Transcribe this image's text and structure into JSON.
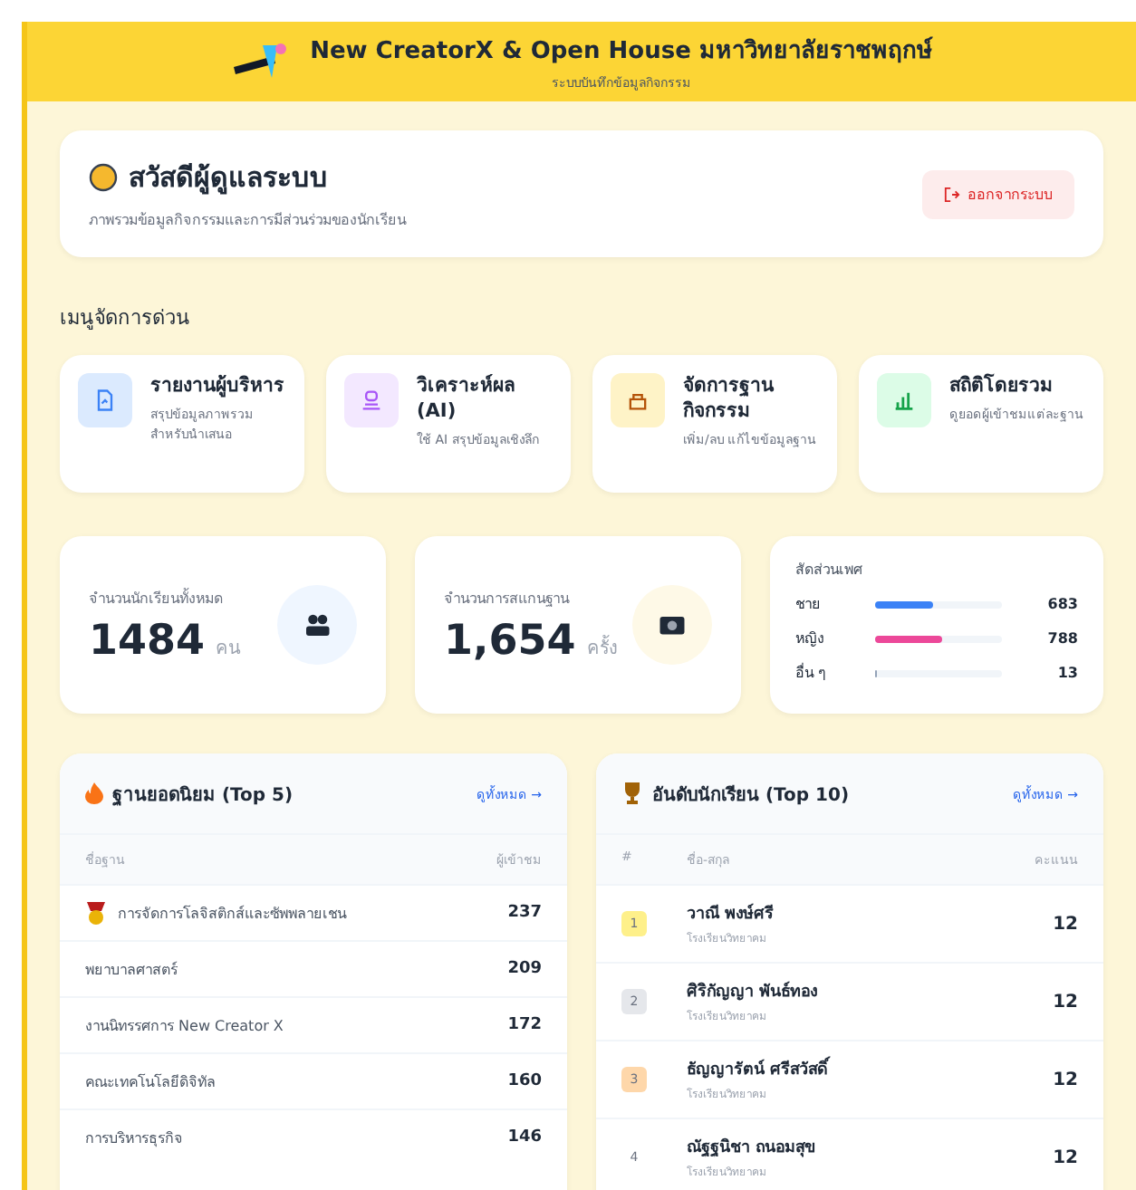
{
  "header": {
    "title": "New CreatorX & Open House มหาวิทยาลัยราชพฤกษ์",
    "subtitle": "ระบบบันทึกข้อมูลกิจกรรม"
  },
  "welcome": {
    "title": "สวัสดีผู้ดูแลระบบ",
    "subtitle": "ภาพรวมข้อมูลกิจกรรมและการมีส่วนร่วมของนักเรียน",
    "logout": "ออกจากระบบ"
  },
  "quick_menu": {
    "title": "เมนูจัดการด่วน",
    "items": [
      {
        "kind": "report",
        "title": "รายงานผู้บริหาร",
        "desc": "สรุปข้อมูลภาพรวมสำหรับนำเสนอ"
      },
      {
        "kind": "ai",
        "title": "วิเคราะห์ผล (AI)",
        "desc": "ใช้ AI สรุปข้อมูลเชิงลึก"
      },
      {
        "kind": "booth",
        "title": "จัดการฐานกิจกรรม",
        "desc": "เพิ่ม/ลบ แก้ไขข้อมูลฐาน"
      },
      {
        "kind": "stats",
        "title": "สถิติโดยรวม",
        "desc": "ดูยอดผู้เข้าชมแต่ละฐาน"
      }
    ]
  },
  "stats": [
    {
      "kind": "students",
      "label": "จำนวนนักเรียนทั้งหมด",
      "value": "1484",
      "unit": "คน"
    },
    {
      "kind": "scans",
      "label": "จำนวนการสแกนฐาน",
      "value": "1,654",
      "unit": "ครั้ง"
    }
  ],
  "gender": {
    "title": "สัดส่วนเพศ",
    "rows": [
      {
        "label": "ชาย",
        "value": "683",
        "level": 0.46,
        "color": "#3b82f6"
      },
      {
        "label": "หญิง",
        "value": "788",
        "level": 0.53,
        "color": "#ec4899"
      },
      {
        "label": "อื่น ๆ",
        "value": "13",
        "level": 0.01,
        "color": "#94a3b8"
      }
    ]
  },
  "top_booths": {
    "title": "ฐานยอดนิยม (Top 5)",
    "link": "ดูทั้งหมด →",
    "columns": [
      "ชื่อฐาน",
      "ผู้เข้าชม"
    ],
    "rows": [
      {
        "kind": "medal",
        "name": "การจัดการโลจิสติกส์และซัพพลายเชน",
        "count": "237"
      },
      {
        "kind": "plain",
        "name": "พยาบาลศาสตร์",
        "count": "209"
      },
      {
        "kind": "plain",
        "name": "งานนิทรรศการ New Creator X",
        "count": "172"
      },
      {
        "kind": "plain",
        "name": "คณะเทคโนโลยีดิจิทัล",
        "count": "160"
      },
      {
        "kind": "plain",
        "name": "การบริหารธุรกิจ",
        "count": "146"
      }
    ]
  },
  "top_students": {
    "title": "อันดับนักเรียน (Top 10)",
    "link": "ดูทั้งหมด →",
    "columns": [
      "#",
      "ชื่อ-สกุล",
      "คะแนน"
    ],
    "rows": [
      {
        "rank": "1",
        "color": "#fef08a",
        "name": "วาณี พงษ์ศรี",
        "school": "โรงเรียนวิทยาคม",
        "score": "12"
      },
      {
        "rank": "2",
        "color": "#e5e7eb",
        "name": "ศิริกัญญา พันธ์ทอง",
        "school": "โรงเรียนวิทยาคม",
        "score": "12"
      },
      {
        "rank": "3",
        "color": "#fed7aa",
        "name": "ธัญญารัตน์ ศรีสวัสดิ์",
        "school": "โรงเรียนวิทยาคม",
        "score": "12"
      },
      {
        "rank": "4",
        "color": "#ffffff",
        "name": "ณัฐฐนิชา ถนอมสุข",
        "school": "โรงเรียนวิทยาคม",
        "score": "12"
      }
    ]
  }
}
